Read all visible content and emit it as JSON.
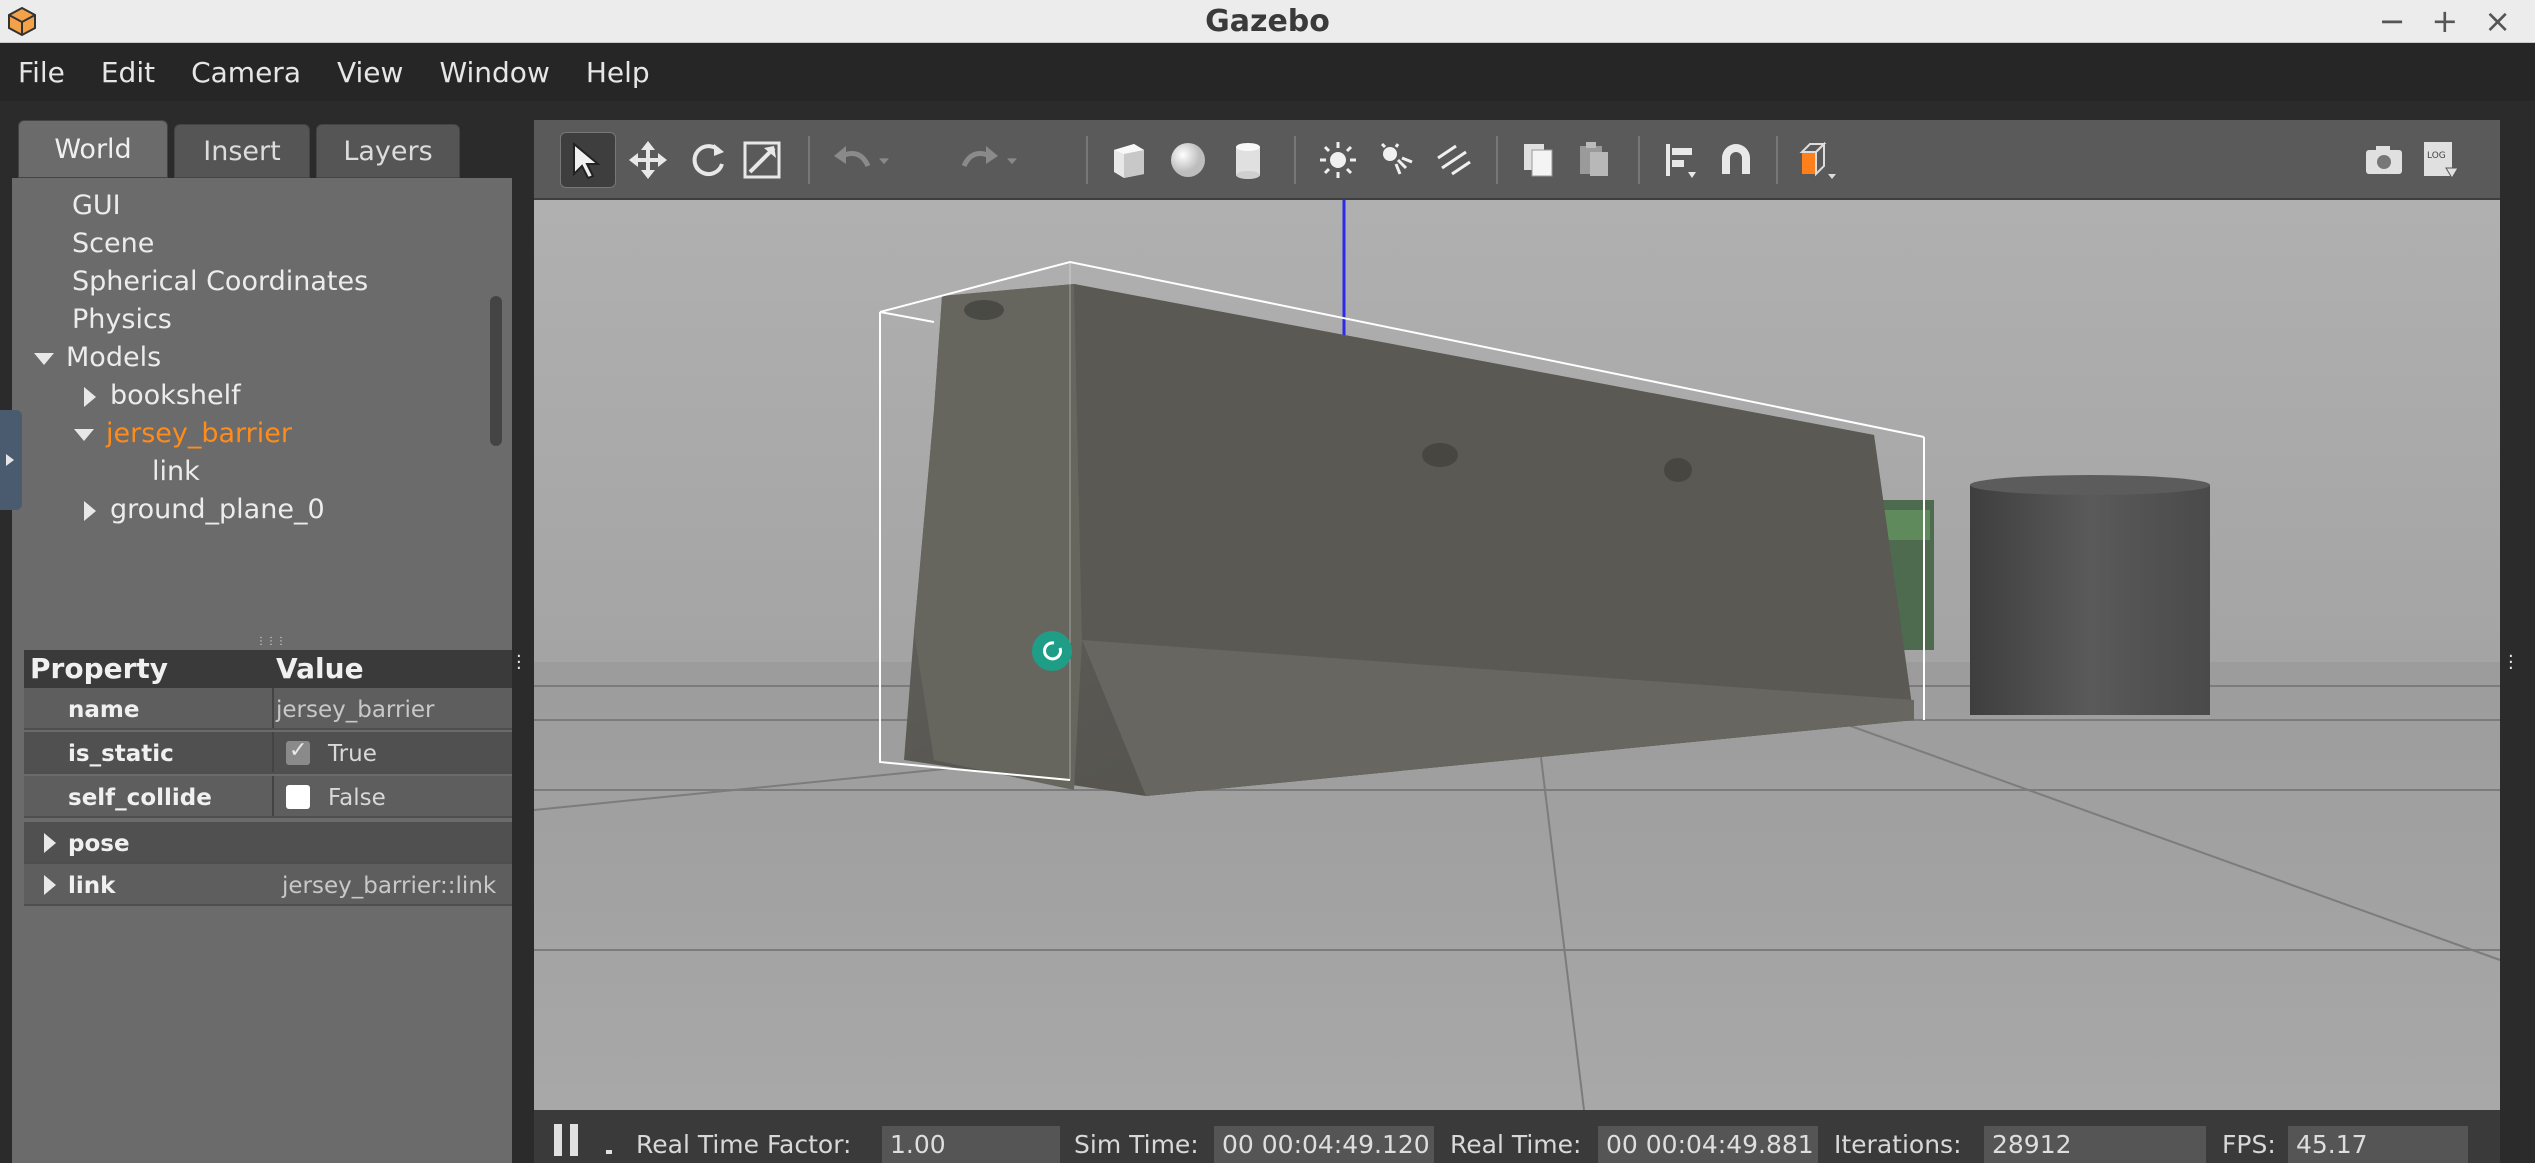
{
  "window": {
    "title": "Gazebo",
    "controls": {
      "minimize": "−",
      "maximize": "+",
      "close": "×"
    },
    "app_icon": "gazebo-logo-icon"
  },
  "menu": [
    "File",
    "Edit",
    "Camera",
    "View",
    "Window",
    "Help"
  ],
  "left_panel": {
    "tabs": [
      "World",
      "Insert",
      "Layers"
    ],
    "active_tab": "World",
    "tree": {
      "gui": "GUI",
      "scene": "Scene",
      "spherical": "Spherical Coordinates",
      "physics": "Physics",
      "models": "Models",
      "model_bookshelf": "bookshelf",
      "model_jersey": "jersey_barrier",
      "jersey_link": "link",
      "model_ground": "ground_plane_0"
    },
    "properties": {
      "header_property": "Property",
      "header_value": "Value",
      "name_label": "name",
      "name_value": "jersey_barrier",
      "is_static_label": "is_static",
      "is_static_value": "True",
      "self_collide_label": "self_collide",
      "self_collide_value": "False",
      "pose_label": "pose",
      "link_label": "link",
      "link_value": "jersey_barrier::link"
    }
  },
  "toolbar": {
    "tools": [
      "select-mode-icon",
      "translate-icon",
      "rotate-icon",
      "scale-icon",
      "undo-icon",
      "redo-icon",
      "box-icon",
      "sphere-icon",
      "cylinder-icon",
      "point-light-icon",
      "spot-light-icon",
      "directional-light-icon",
      "copy-icon",
      "paste-icon",
      "align-icon",
      "snap-icon",
      "view-angle-icon",
      "screenshot-icon",
      "log-icon"
    ],
    "log_text": "LOG"
  },
  "status": {
    "rtf_label": "Real Time Factor:",
    "rtf_value": "1.00",
    "sim_label": "Sim Time:",
    "sim_value": "00 00:04:49.120",
    "real_label": "Real Time:",
    "real_value": "00 00:04:49.881",
    "iter_label": "Iterations:",
    "iter_value": "28912",
    "fps_label": "FPS:",
    "fps_value": "45.17"
  },
  "colors": {
    "selected_model": "#ff8c1a",
    "viewport_bg": "#a8a8a8",
    "panel_bg": "#6b6b6b",
    "view_angle_cube": "#ff7f1a"
  }
}
